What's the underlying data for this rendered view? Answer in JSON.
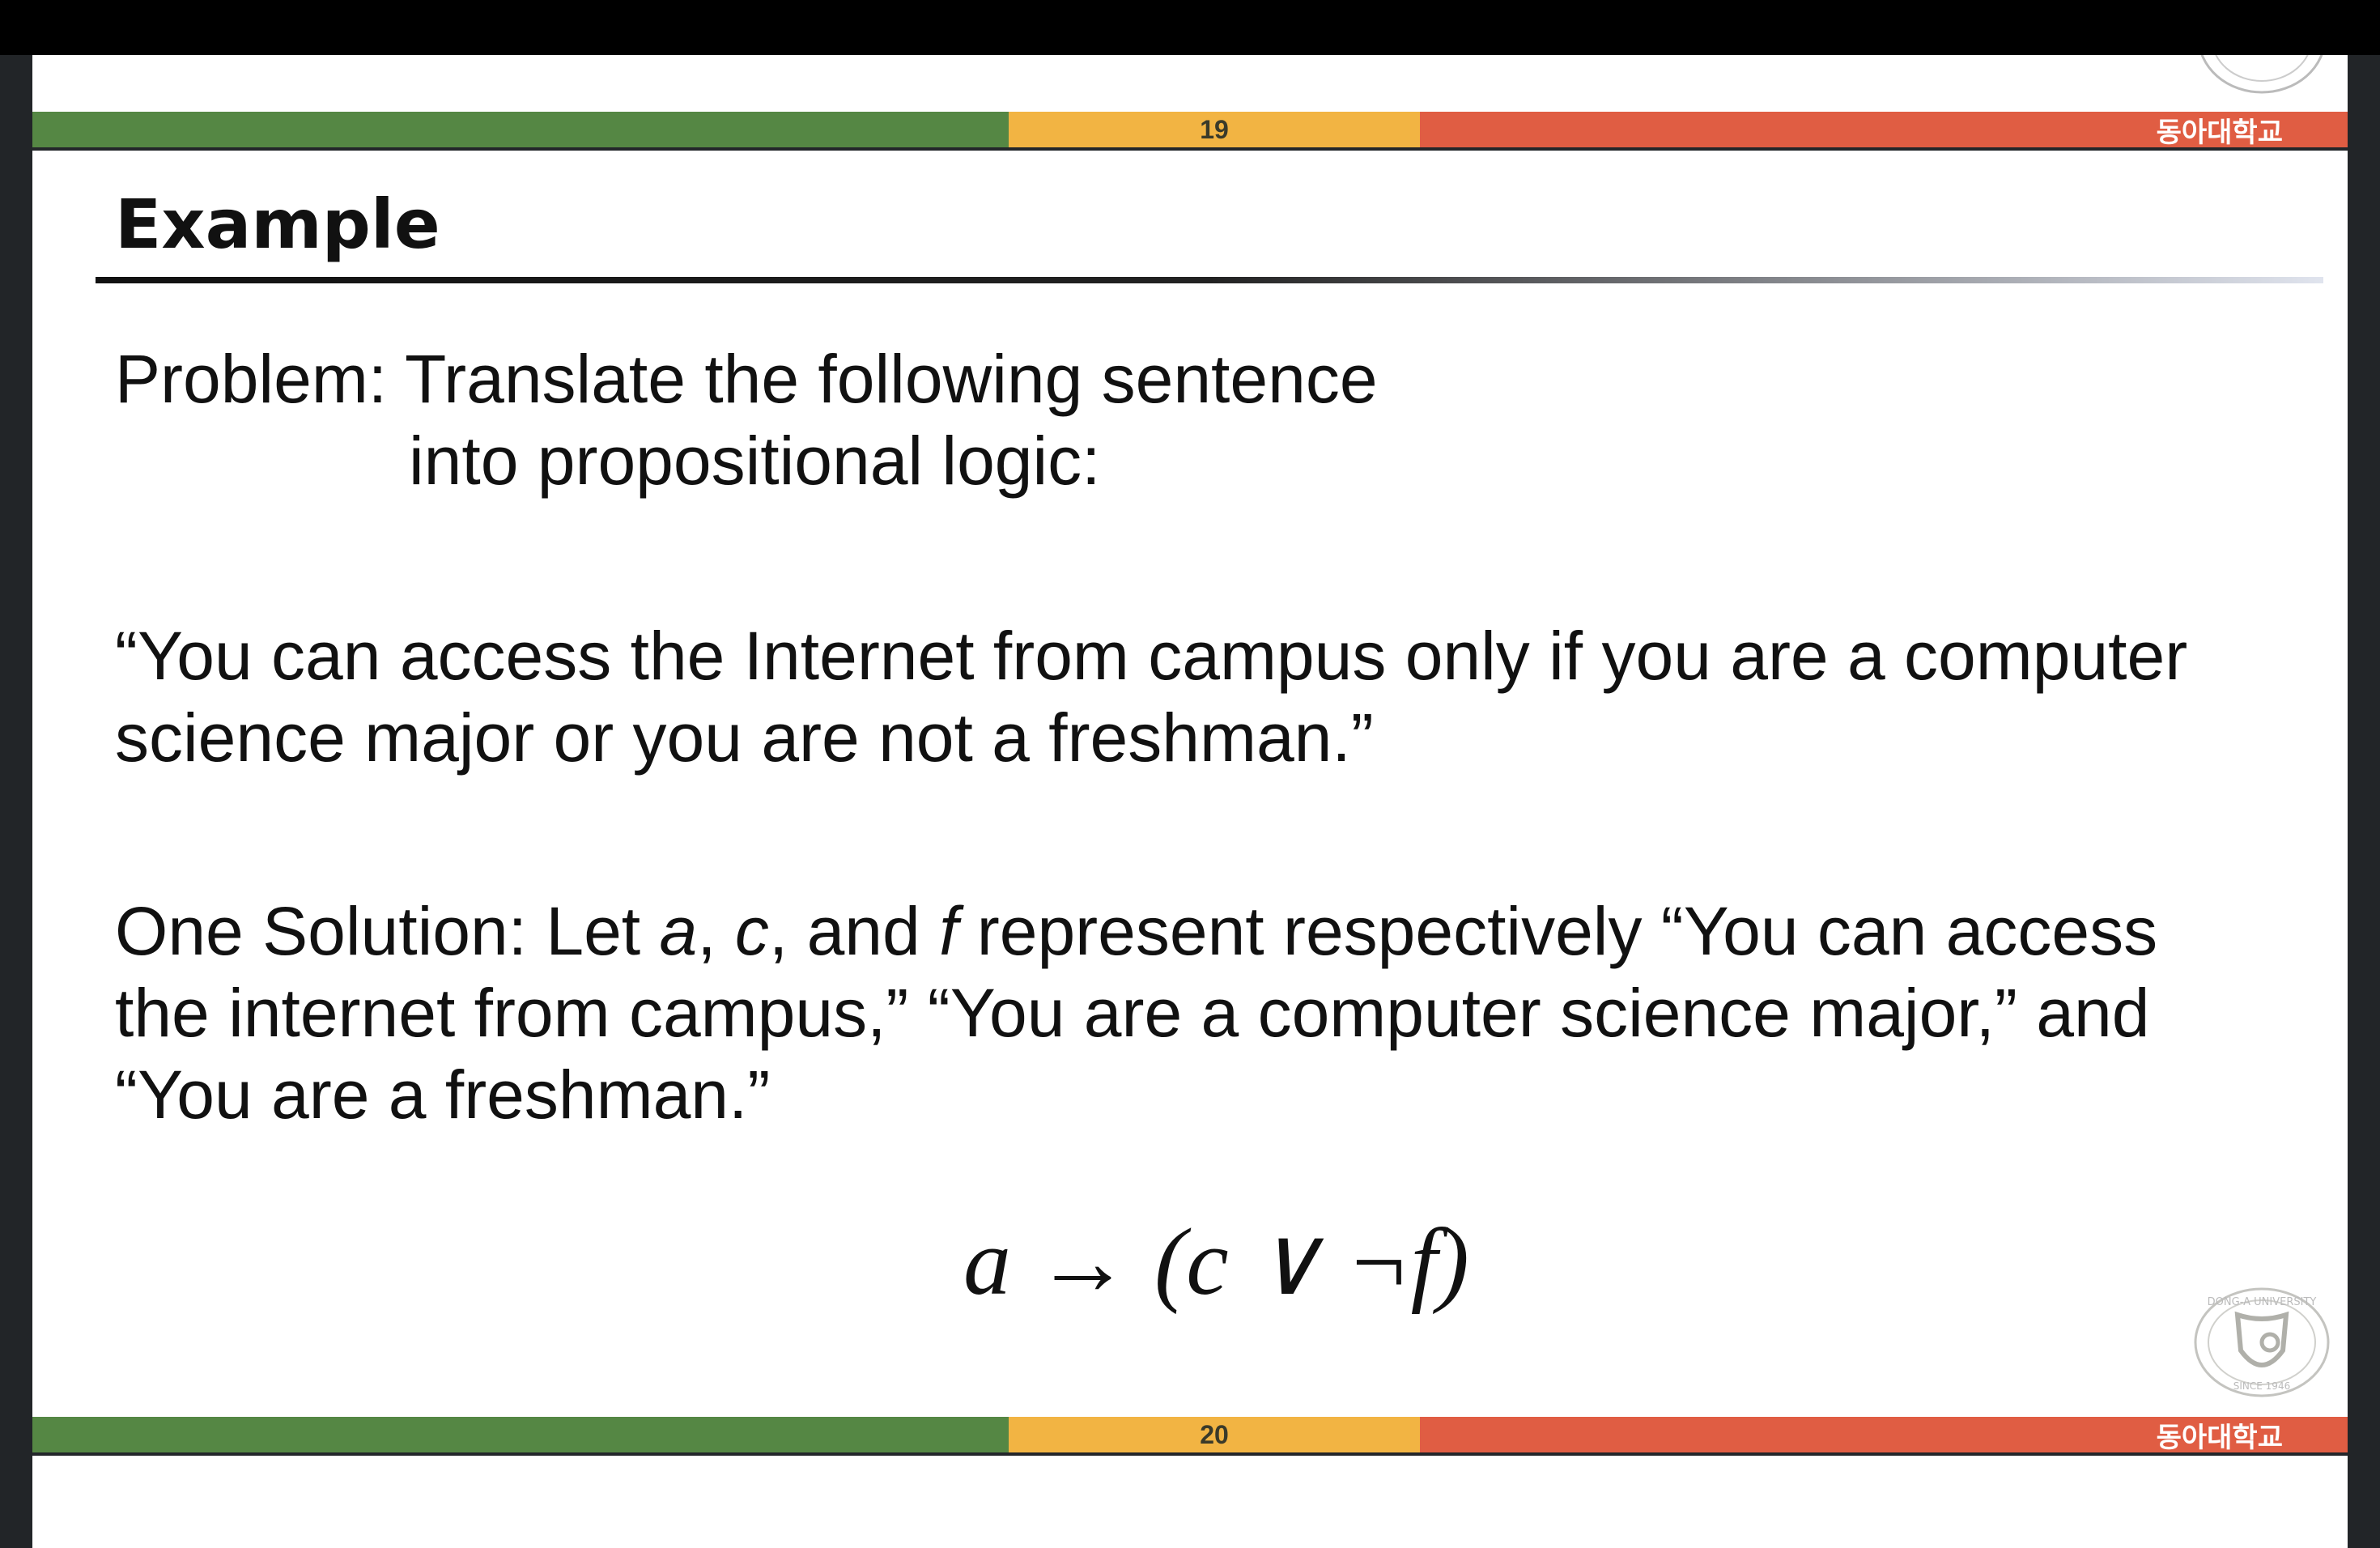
{
  "slides": [
    {
      "page_number": "19",
      "university": "동아대학교"
    },
    {
      "page_number": "20",
      "university": "동아대학교"
    }
  ],
  "title": "Example",
  "problem": {
    "label": "Problem:",
    "line1": "Translate the following sentence",
    "line2": "into propositional logic:"
  },
  "quote": {
    "line1": "“You can access the Internet from campus only if you are a computer",
    "line2": "science major or you are not a freshman.”"
  },
  "solution": {
    "label": "One Solution:",
    "let": "Let",
    "var_a": "a",
    "var_c": "c",
    "and": "and",
    "var_f": "f",
    "line1_rest": "represent respectively “You can access",
    "line2": "the internet from campus,” “You are a computer science major,” and",
    "line3": "“You are a freshman.”"
  },
  "formula": "a → (c ∨ ¬f)",
  "logo": {
    "text_top": "DONG-A UNIVERSITY",
    "text_bottom": "SINCE 1946"
  },
  "colors": {
    "green": "#558744",
    "yellow": "#f2b443",
    "red": "#e05d43"
  }
}
